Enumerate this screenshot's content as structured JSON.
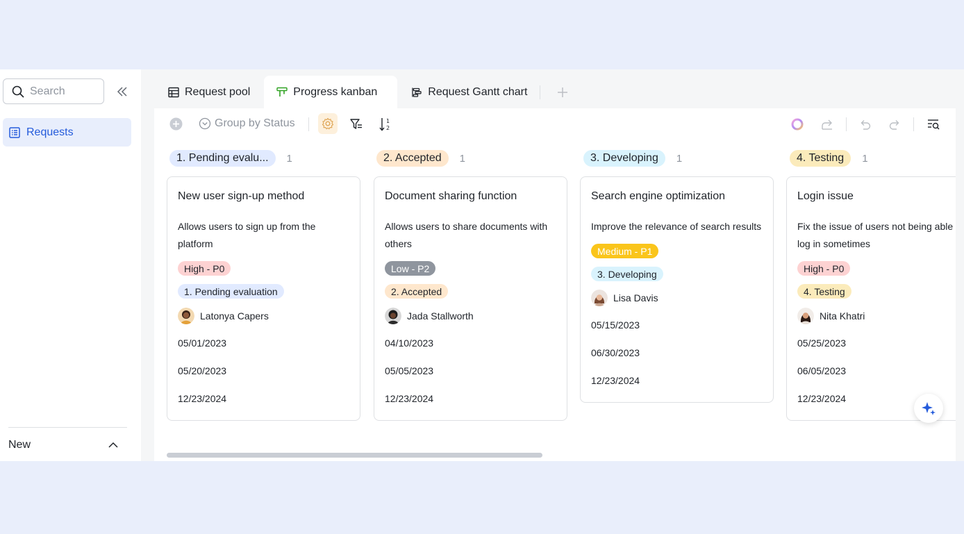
{
  "sidebar": {
    "search_placeholder": "Search",
    "nav_label": "Requests",
    "new_label": "New"
  },
  "tabs": [
    {
      "label": "Request pool",
      "icon": "table-icon"
    },
    {
      "label": "Progress kanban",
      "icon": "kanban-icon",
      "active": true
    },
    {
      "label": "Request Gantt chart",
      "icon": "gantt-icon"
    }
  ],
  "toolbar": {
    "group_label": "Group by Status"
  },
  "columns": [
    {
      "status": "1. Pending evalu...",
      "count": "1",
      "color": "#e1eaff",
      "card": {
        "title": "New user sign-up method",
        "desc_lines": [
          "Allows users to sign up from the",
          "platform"
        ],
        "priority": "High - P0",
        "status": "1. Pending evaluation",
        "assignee": "Latonya Capers",
        "dates": [
          "05/01/2023",
          "05/20/2023",
          "12/23/2024"
        ]
      }
    },
    {
      "status": "2. Accepted",
      "count": "1",
      "color": "#fee7cd",
      "card": {
        "title": "Document sharing function",
        "desc_lines": [
          "Allows users to share documents with",
          "others"
        ],
        "priority": "Low - P2",
        "status": "2. Accepted",
        "assignee": "Jada Stallworth",
        "dates": [
          "04/10/2023",
          "05/05/2023",
          "12/23/2024"
        ]
      }
    },
    {
      "status": "3. Developing",
      "count": "1",
      "color": "#d9f3fd",
      "card": {
        "title": "Search engine optimization",
        "desc_lines": [
          "Improve the relevance of search results"
        ],
        "priority": "Medium - P1",
        "status": "3. Developing",
        "assignee": "Lisa Davis",
        "dates": [
          "05/15/2023",
          "06/30/2023",
          "12/23/2024"
        ]
      }
    },
    {
      "status": "4. Testing",
      "count": "1",
      "color": "#fbebbb",
      "card": {
        "title": "Login issue",
        "desc_lines": [
          "Fix the issue of users not being able t",
          "log in sometimes"
        ],
        "priority": "High - P0",
        "status": "4. Testing",
        "assignee": "Nita Khatri",
        "dates": [
          "05/25/2023",
          "06/05/2023",
          "12/23/2024"
        ]
      }
    }
  ],
  "colors": {
    "accent": "#245bdb",
    "priority_high": "#fdd2d2",
    "priority_low": "#8f959e",
    "priority_medium": "#fac51b"
  }
}
